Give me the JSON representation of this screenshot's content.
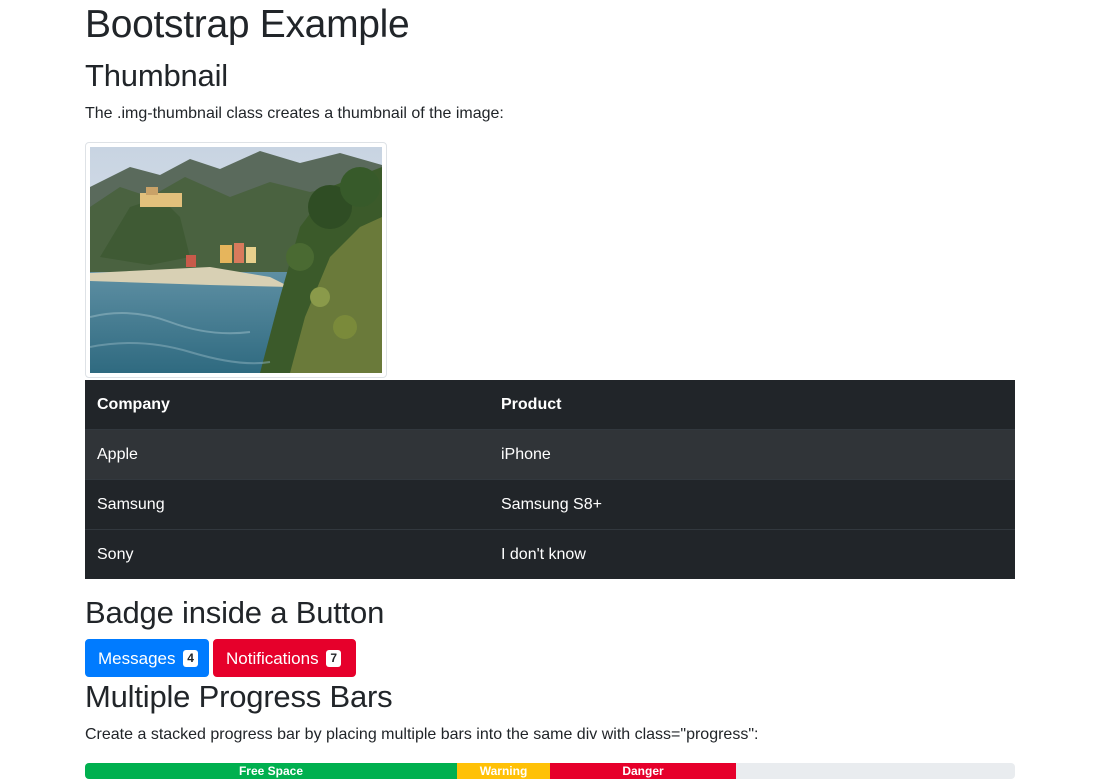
{
  "page": {
    "title": "Bootstrap Example"
  },
  "thumbnail_section": {
    "heading": "Thumbnail",
    "description": "The .img-thumbnail class creates a thumbnail of the image:",
    "image_alt": "Cinque Terre"
  },
  "table": {
    "headers": [
      "Company",
      "Product"
    ],
    "rows": [
      [
        "Apple",
        "iPhone"
      ],
      [
        "Samsung",
        "Samsung S8+"
      ],
      [
        "Sony",
        "I don't know"
      ]
    ]
  },
  "badge_section": {
    "heading": "Badge inside a Button",
    "buttons": [
      {
        "label": "Messages",
        "badge": "4",
        "color": "#007bff"
      },
      {
        "label": "Notifications",
        "badge": "7",
        "color": "#e6002b"
      }
    ]
  },
  "progress_section": {
    "heading": "Multiple Progress Bars",
    "description": "Create a stacked progress bar by placing multiple bars into the same div with class=\"progress\":",
    "bars": [
      {
        "label": "Free Space",
        "percent": 40,
        "color": "#00b04f"
      },
      {
        "label": "Warning",
        "percent": 10,
        "color": "#ffc107"
      },
      {
        "label": "Danger",
        "percent": 20,
        "color": "#e6002b"
      }
    ]
  }
}
